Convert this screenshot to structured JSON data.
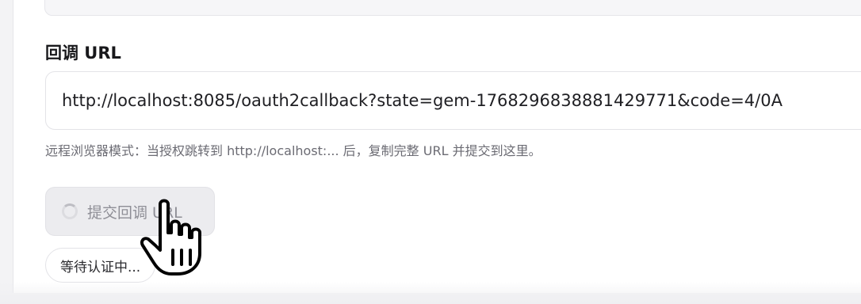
{
  "callback": {
    "label": "回调 URL",
    "input_value": "http://localhost:8085/oauth2callback?state=gem-1768296838881429771&code=4/0A",
    "hint": "远程浏览器模式：当授权跳转到 http://localhost:... 后，复制完整 URL 并提交到这里。"
  },
  "submit_button": {
    "label": "提交回调 URL",
    "state": "loading",
    "spinner_icon": "loading-spinner-icon"
  },
  "status": {
    "text": "等待认证中..."
  },
  "cursor": {
    "icon": "hand-pointer-cursor-icon"
  }
}
